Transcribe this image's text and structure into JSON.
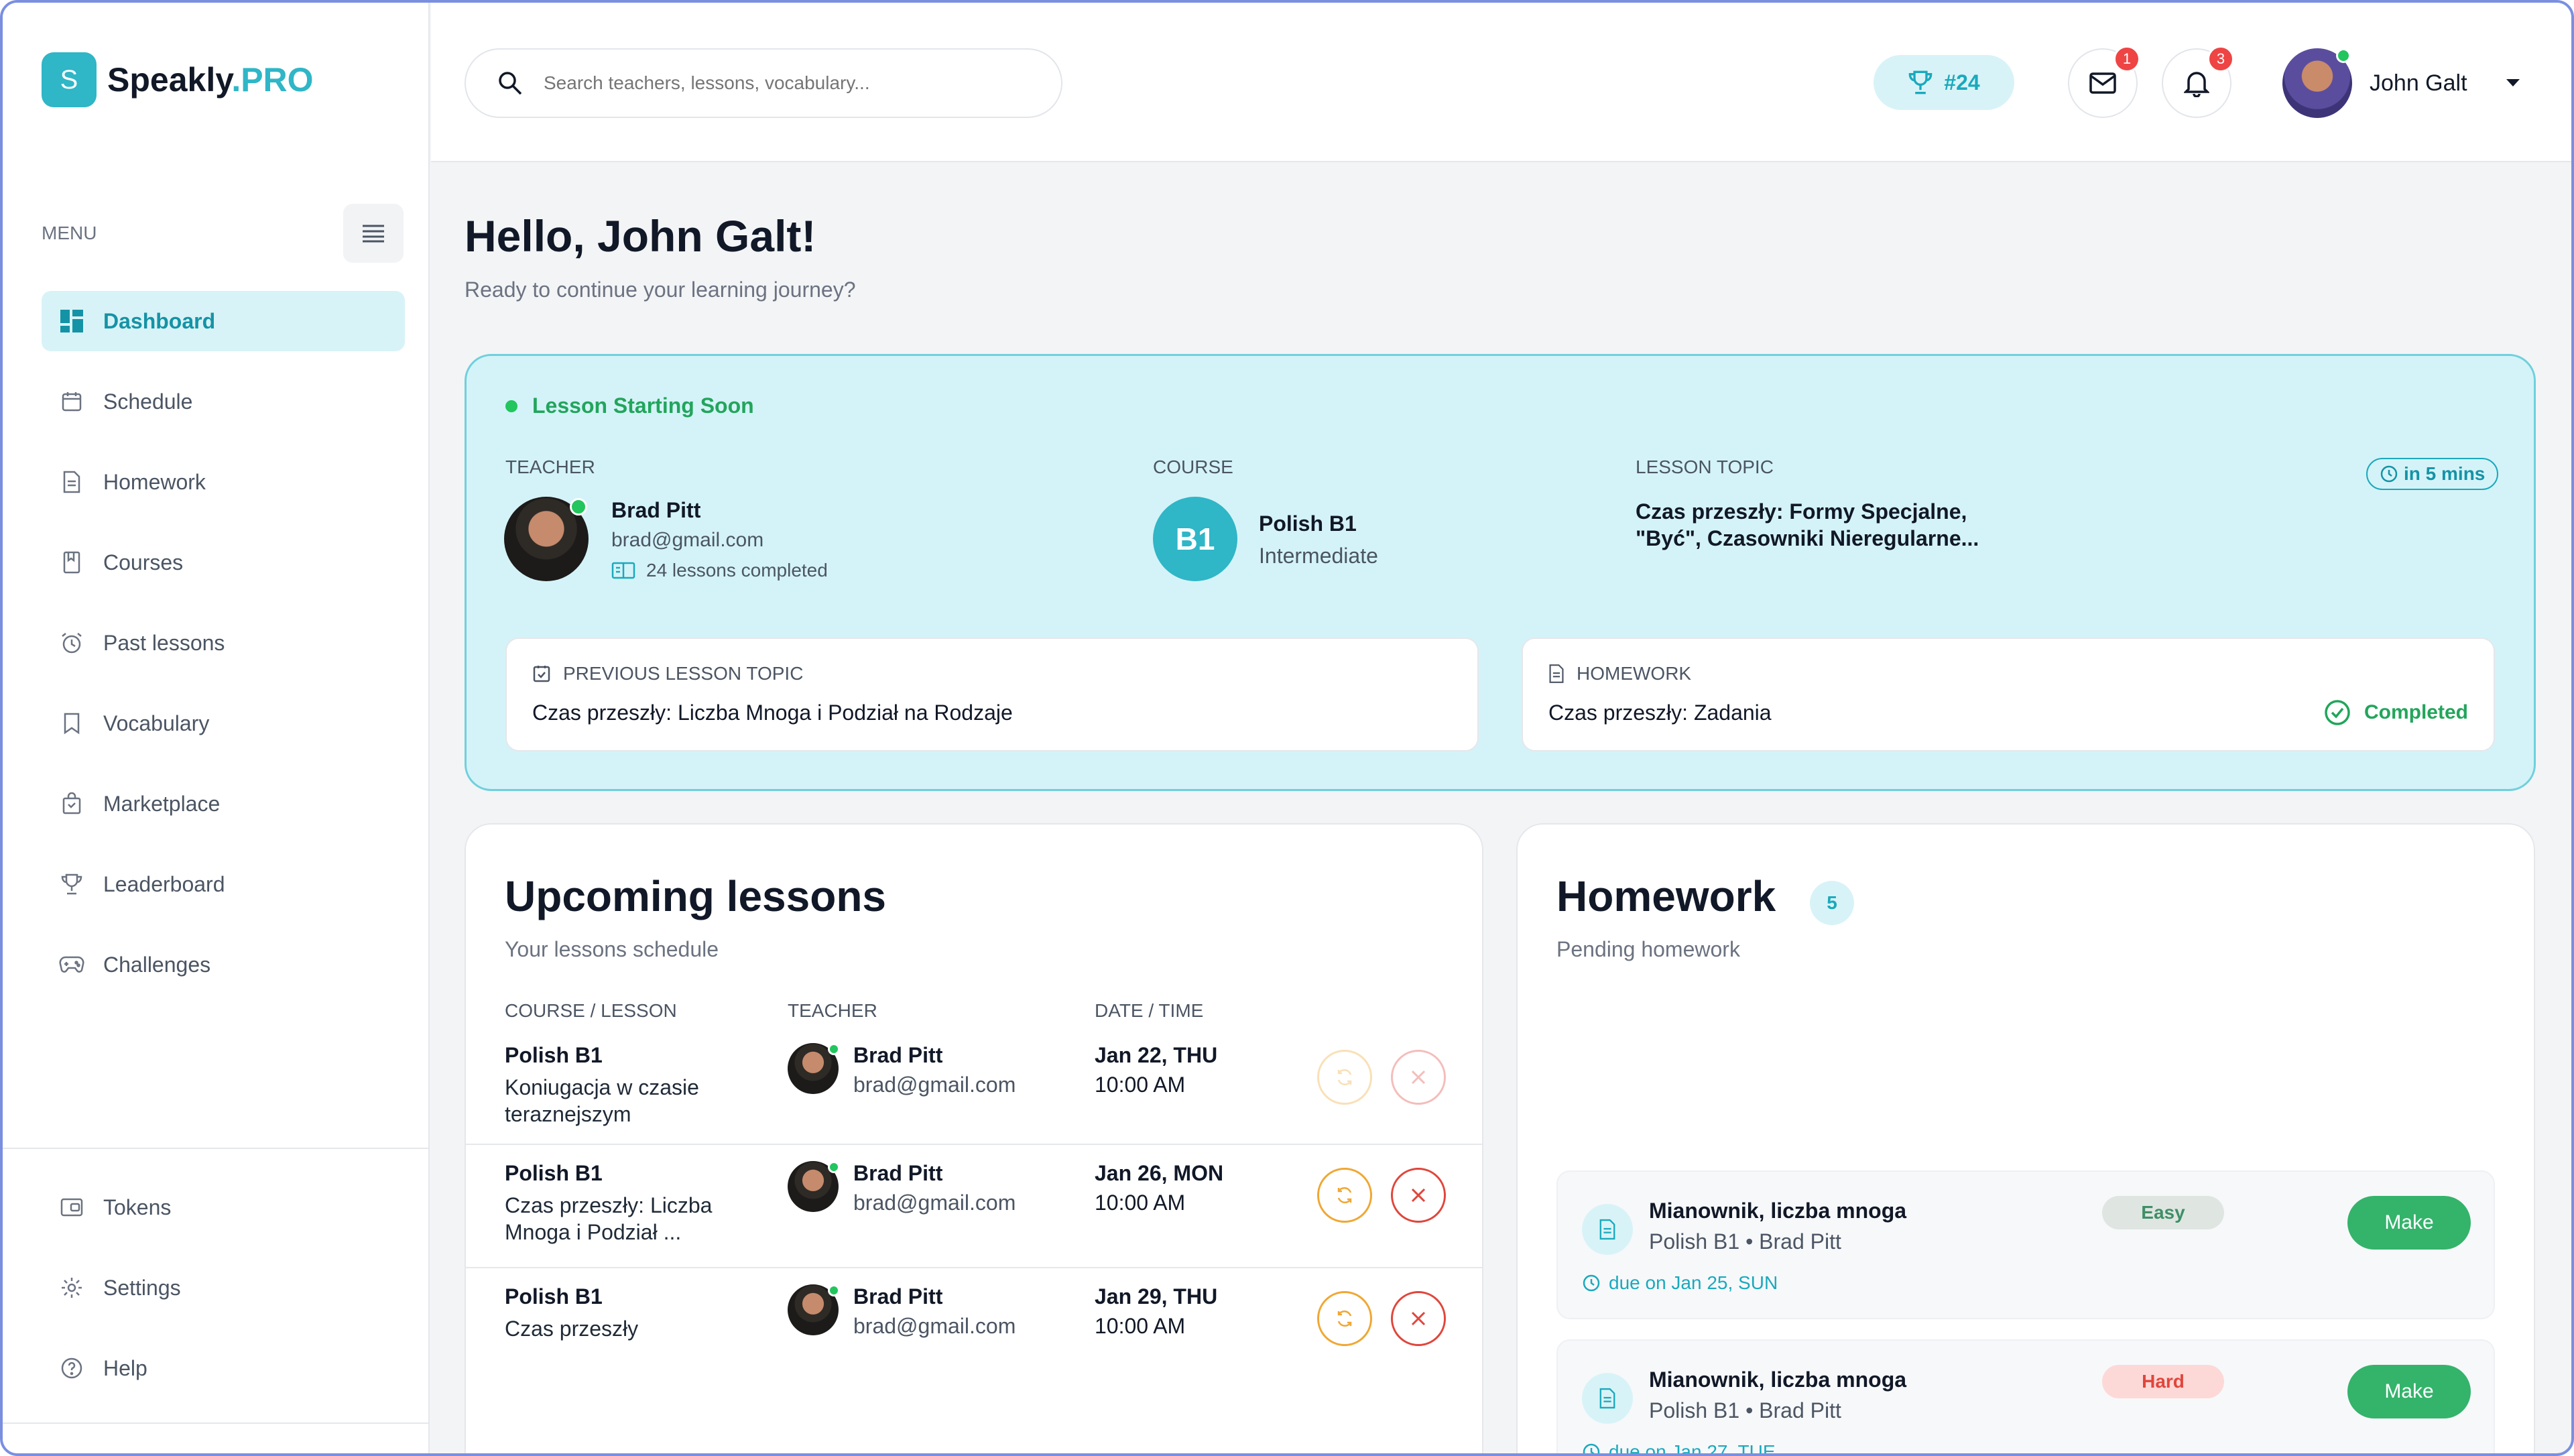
{
  "app": {
    "logo_letter": "S",
    "name": "Speakly",
    "name_suffix": ".PRO",
    "brand_color": "#2fb6c7"
  },
  "sidebar": {
    "menu_label": "MENU",
    "items": [
      {
        "label": "Dashboard",
        "icon": "dashboard-icon",
        "active": true
      },
      {
        "label": "Schedule",
        "icon": "calendar-icon"
      },
      {
        "label": "Homework",
        "icon": "document-icon"
      },
      {
        "label": "Courses",
        "icon": "book-icon"
      },
      {
        "label": "Past lessons",
        "icon": "alarm-clock-icon"
      },
      {
        "label": "Vocabulary",
        "icon": "bookmark-icon"
      },
      {
        "label": "Marketplace",
        "icon": "shopping-bag-icon"
      },
      {
        "label": "Leaderboard",
        "icon": "trophy-icon"
      },
      {
        "label": "Challenges",
        "icon": "gamepad-icon"
      }
    ],
    "bottom_items": [
      {
        "label": "Tokens",
        "icon": "wallet-icon"
      },
      {
        "label": "Settings",
        "icon": "gear-icon"
      },
      {
        "label": "Help",
        "icon": "help-circle-icon"
      }
    ]
  },
  "header": {
    "search_placeholder": "Search teachers, lessons, vocabulary...",
    "rank": "#24",
    "messages_count": "1",
    "notifications_count": "3",
    "user_name": "John Galt"
  },
  "main": {
    "greeting": "Hello, John Galt!",
    "subgreeting": "Ready to continue your learning journey?",
    "next_lesson": {
      "status": "Lesson Starting Soon",
      "teacher_label": "TEACHER",
      "teacher_name": "Brad Pitt",
      "teacher_email": "brad@gmail.com",
      "lessons_completed": "24 lessons completed",
      "course_label": "COURSE",
      "course_badge": "B1",
      "course_name": "Polish B1",
      "course_level": "Intermediate",
      "topic_label": "LESSON TOPIC",
      "topic": "Czas przeszły: Formy Specjalne, \"Być\", Czasowniki Nieregularne...",
      "starts_in": "in 5 mins",
      "previous_label": "PREVIOUS LESSON TOPIC",
      "previous_topic": "Czas przeszły: Liczba Mnoga i Podział na Rodzaje",
      "homework_label": "HOMEWORK",
      "homework_topic": "Czas przeszły: Zadania",
      "homework_status": "Completed"
    },
    "upcoming": {
      "title": "Upcoming lessons",
      "subtitle": "Your lessons schedule",
      "col_course": "COURSE / LESSON",
      "col_teacher": "TEACHER",
      "col_date": "DATE / TIME",
      "rows": [
        {
          "course": "Polish B1",
          "lesson": "Koniugacja w czasie teraznejszym",
          "teacher": "Brad Pitt",
          "email": "brad@gmail.com",
          "date": "Jan 22, THU",
          "time": "10:00 AM"
        },
        {
          "course": "Polish B1",
          "lesson": "Czas przeszły: Liczba Mnoga i Podział ...",
          "teacher": "Brad Pitt",
          "email": "brad@gmail.com",
          "date": "Jan 26, MON",
          "time": "10:00 AM"
        },
        {
          "course": "Polish B1",
          "lesson": "Czas przeszły",
          "teacher": "Brad Pitt",
          "email": "brad@gmail.com",
          "date": "Jan 29, THU",
          "time": "10:00 AM"
        }
      ]
    },
    "homework": {
      "title": "Homework",
      "count": "5",
      "subtitle": "Pending homework",
      "items": [
        {
          "title": "Mianownik, liczba mnoga",
          "meta": "Polish B1 • Brad Pitt",
          "due": "due on Jan 25, SUN",
          "difficulty": "Easy",
          "action": "Make"
        },
        {
          "title": "Mianownik, liczba mnoga",
          "meta": "Polish B1 • Brad Pitt",
          "due": "due on Jan 27, TUE",
          "difficulty": "Hard",
          "action": "Make"
        }
      ]
    }
  }
}
